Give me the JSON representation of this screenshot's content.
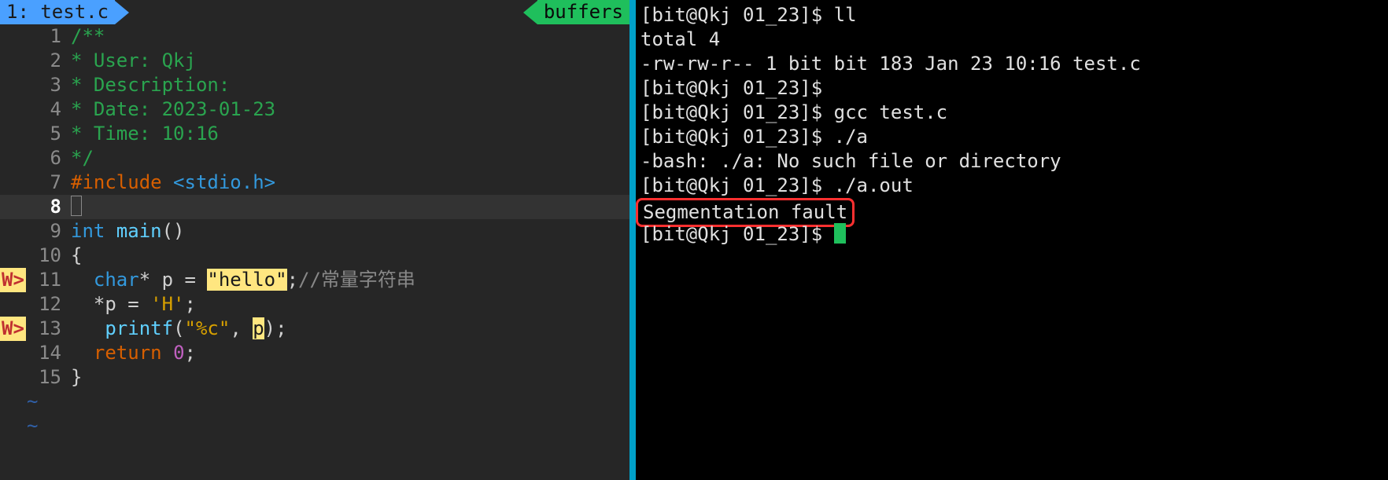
{
  "editor": {
    "tab_left": "1: test.c",
    "tab_right": "buffers",
    "lines": [
      {
        "num": 1,
        "warn": "",
        "tokens": [
          {
            "cls": "c-comment",
            "t": "/**"
          }
        ]
      },
      {
        "num": 2,
        "warn": "",
        "tokens": [
          {
            "cls": "c-comment",
            "t": "* User: Qkj"
          }
        ]
      },
      {
        "num": 3,
        "warn": "",
        "tokens": [
          {
            "cls": "c-comment",
            "t": "* Description:"
          }
        ]
      },
      {
        "num": 4,
        "warn": "",
        "tokens": [
          {
            "cls": "c-comment",
            "t": "* Date: 2023-01-23"
          }
        ]
      },
      {
        "num": 5,
        "warn": "",
        "tokens": [
          {
            "cls": "c-comment",
            "t": "* Time: 10:16"
          }
        ]
      },
      {
        "num": 6,
        "warn": "",
        "tokens": [
          {
            "cls": "c-comment",
            "t": "*/"
          }
        ]
      },
      {
        "num": 7,
        "warn": "",
        "tokens": [
          {
            "cls": "c-keyword",
            "t": "#include "
          },
          {
            "cls": "c-include",
            "t": "<stdio.h>"
          }
        ]
      },
      {
        "num": 8,
        "warn": "",
        "current": true,
        "tokens": [
          {
            "cls": "",
            "t": "",
            "cursor": true
          }
        ]
      },
      {
        "num": 9,
        "warn": "",
        "tokens": [
          {
            "cls": "c-type",
            "t": "int "
          },
          {
            "cls": "c-func",
            "t": "main"
          },
          {
            "cls": "c-op",
            "t": "()"
          }
        ]
      },
      {
        "num": 10,
        "warn": "",
        "tokens": [
          {
            "cls": "c-op",
            "t": "{"
          }
        ]
      },
      {
        "num": 11,
        "warn": "W>",
        "tokens": [
          {
            "cls": "",
            "t": "  "
          },
          {
            "cls": "c-type",
            "t": "char"
          },
          {
            "cls": "c-op",
            "t": "* p = "
          },
          {
            "cls": "c-string hl-yellow",
            "t": "\"hello\""
          },
          {
            "cls": "c-op",
            "t": ";"
          },
          {
            "cls": "c-cncomment",
            "t": "//常量字符串"
          }
        ]
      },
      {
        "num": 12,
        "warn": "",
        "tokens": [
          {
            "cls": "",
            "t": "  "
          },
          {
            "cls": "c-op",
            "t": "*p = "
          },
          {
            "cls": "c-string",
            "t": "'H'"
          },
          {
            "cls": "c-op",
            "t": ";"
          }
        ]
      },
      {
        "num": 13,
        "warn": "W>",
        "tokens": [
          {
            "cls": "",
            "t": "   "
          },
          {
            "cls": "c-func",
            "t": "printf"
          },
          {
            "cls": "c-op",
            "t": "("
          },
          {
            "cls": "c-string",
            "t": "\"%c\""
          },
          {
            "cls": "c-op",
            "t": ", "
          },
          {
            "cls": "hl-yellow",
            "t": "p"
          },
          {
            "cls": "c-op",
            "t": ");"
          }
        ]
      },
      {
        "num": 14,
        "warn": "",
        "tokens": [
          {
            "cls": "",
            "t": "  "
          },
          {
            "cls": "c-keyword",
            "t": "return "
          },
          {
            "cls": "c-number",
            "t": "0"
          },
          {
            "cls": "c-op",
            "t": ";"
          }
        ]
      },
      {
        "num": 15,
        "warn": "",
        "tokens": [
          {
            "cls": "c-op",
            "t": "}"
          }
        ]
      }
    ],
    "trailing_tildes": [
      "~",
      "~"
    ]
  },
  "terminal": {
    "lines": [
      "[bit@Qkj 01_23]$ ll",
      "total 4",
      "-rw-rw-r-- 1 bit bit 183 Jan 23 10:16 test.c",
      "[bit@Qkj 01_23]$ ",
      "[bit@Qkj 01_23]$ gcc test.c",
      "[bit@Qkj 01_23]$ ./a",
      "-bash: ./a: No such file or directory",
      "[bit@Qkj 01_23]$ ./a.out"
    ],
    "segfault_text": "Segmentation fault",
    "final_prompt": "[bit@Qkj 01_23]$ "
  }
}
